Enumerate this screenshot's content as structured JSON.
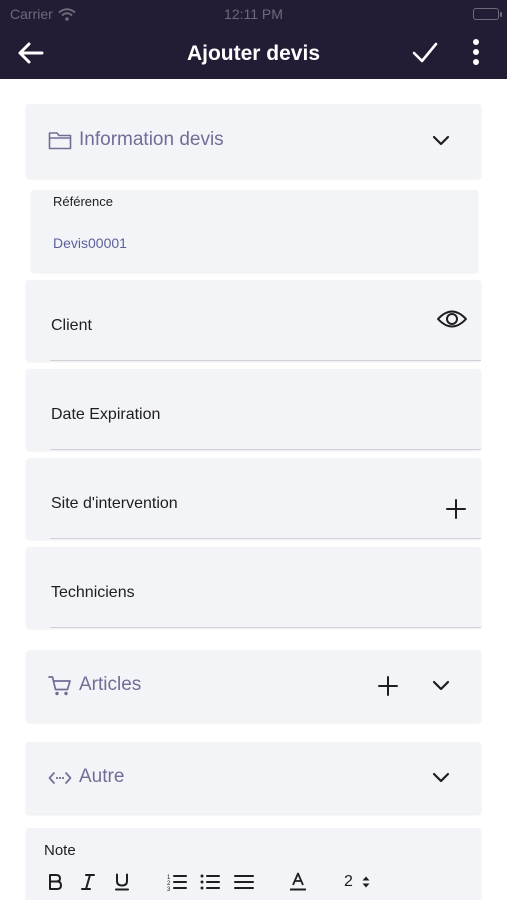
{
  "status_bar": {
    "carrier": "Carrier",
    "time": "12:11 PM"
  },
  "header": {
    "title": "Ajouter devis"
  },
  "info_section": {
    "title": "Information devis"
  },
  "reference": {
    "label": "Référence",
    "value": "Devis00001"
  },
  "fields": {
    "client": "Client",
    "date_expiration": "Date Expiration",
    "site": "Site d'intervention",
    "techniciens": "Techniciens"
  },
  "articles_section": {
    "title": "Articles"
  },
  "autre_section": {
    "title": "Autre"
  },
  "note": {
    "label": "Note",
    "font_size_value": "2"
  },
  "colors": {
    "header_bg": "#241b35",
    "card_bg": "#f3f4f8",
    "section_text": "#6f6e97",
    "reference_value": "#5b5f9a"
  }
}
